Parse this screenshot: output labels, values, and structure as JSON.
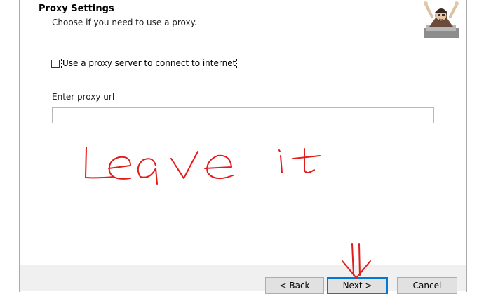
{
  "header": {
    "title": "Proxy Settings",
    "subtitle": "Choose if you need to use a proxy."
  },
  "proxy": {
    "checkbox_label": "Use a proxy server to connect to internet",
    "checkbox_checked": false,
    "url_label": "Enter proxy url",
    "url_value": ""
  },
  "annotation": {
    "handwritten_text": "Leave it",
    "color": "#e31b1b"
  },
  "buttons": {
    "back": "< Back",
    "next": "Next >",
    "cancel": "Cancel"
  },
  "colors": {
    "accent": "#0078d7",
    "footer_bg": "#f0f0f0"
  }
}
